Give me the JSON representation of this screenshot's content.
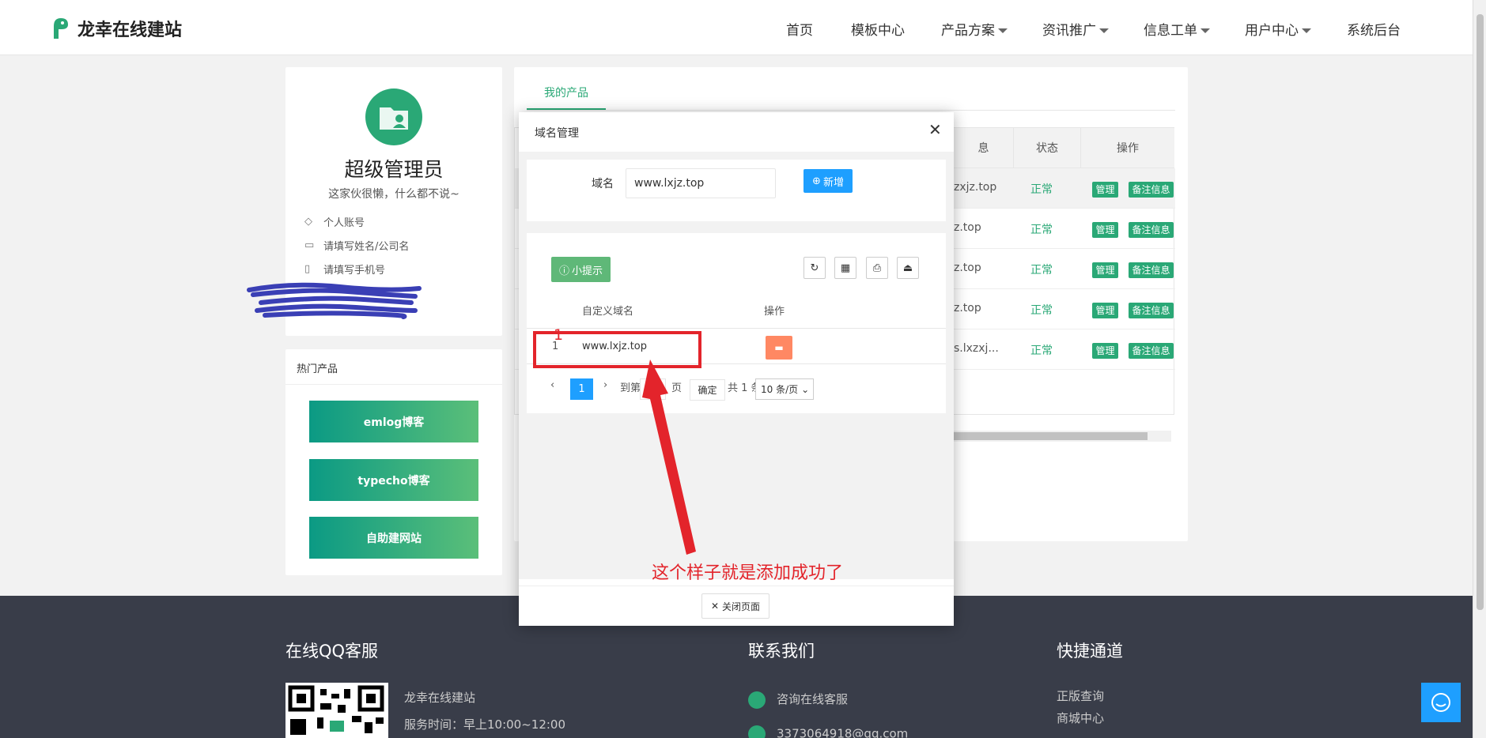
{
  "header": {
    "site_name": "龙幸在线建站",
    "nav": [
      "首页",
      "模板中心",
      "产品方案",
      "资讯推广",
      "信息工单",
      "用户中心",
      "系统后台"
    ]
  },
  "profile": {
    "name": "超级管理员",
    "motto": "这家伙很懒，什么都不说~",
    "account_label": "个人账号",
    "name_placeholder": "请填写姓名/公司名",
    "phone_placeholder": "请填写手机号"
  },
  "hot": {
    "title": "热门产品",
    "items": [
      "emlog博客",
      "typecho博客",
      "自助建网站"
    ]
  },
  "main": {
    "tab": "我的产品",
    "table": {
      "headers": [
        "息",
        "状态",
        "操作"
      ],
      "rows": [
        {
          "domain": "zxjz.top",
          "status": "正常",
          "manage": "管理",
          "note": "备注信息"
        },
        {
          "domain": "z.top",
          "status": "正常",
          "manage": "管理",
          "note": "备注信息"
        },
        {
          "domain": "z.top",
          "status": "正常",
          "manage": "管理",
          "note": "备注信息"
        },
        {
          "domain": "z.top",
          "status": "正常",
          "manage": "管理",
          "note": "备注信息"
        },
        {
          "domain": "s.lxzxj...",
          "status": "正常",
          "manage": "管理",
          "note": "备注信息"
        }
      ]
    }
  },
  "modal": {
    "title": "域名管理",
    "domain_label": "域名",
    "domain_value": "www.lxjz.top",
    "add_label": "新增",
    "tip_label": "小提示",
    "col_domain": "自定义域名",
    "col_action": "操作",
    "row_index": "1",
    "row_domain": "www.lxjz.top",
    "pager": {
      "current": "1",
      "goto": "到第",
      "goto_value": "1",
      "page_word": "页",
      "confirm": "确定",
      "total": "共 1 条",
      "per_page": "10 条/页"
    },
    "close_label": "关闭页面"
  },
  "annotation": {
    "marker": "1",
    "text": "这个样子就是添加成功了"
  },
  "footer": {
    "qq_title": "在线QQ客服",
    "site": "龙幸在线建站",
    "hours": "服务时间：早上10:00~12:00",
    "contact_title": "联系我们",
    "consult": "咨询在线客服",
    "email": "3373064918@qq.com",
    "quick_title": "快捷通道",
    "links": [
      "正版查询",
      "商城中心"
    ]
  },
  "colors": {
    "accent": "#2aa876",
    "blue": "#1e9fff",
    "annotation_red": "#e3242b",
    "footer_bg": "#393d49"
  }
}
